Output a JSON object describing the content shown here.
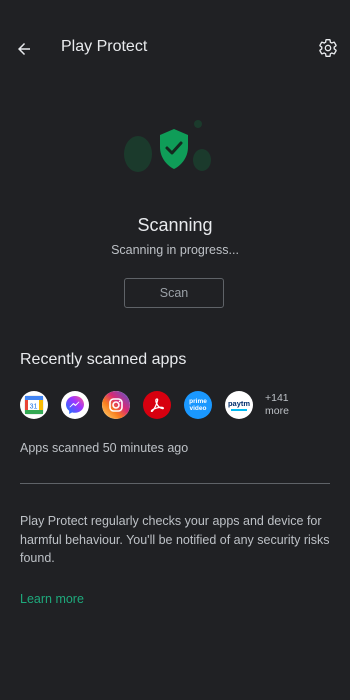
{
  "header": {
    "title": "Play Protect"
  },
  "status": {
    "title": "Scanning",
    "subtitle": "Scanning in progress..."
  },
  "scan_button": {
    "label": "Scan"
  },
  "recent": {
    "title": "Recently scanned apps",
    "apps": [
      {
        "name": "calendar-app-icon",
        "label": "31"
      },
      {
        "name": "messenger-app-icon"
      },
      {
        "name": "instagram-app-icon"
      },
      {
        "name": "acrobat-app-icon"
      },
      {
        "name": "prime-video-app-icon",
        "label_top": "prime",
        "label_bottom": "video"
      },
      {
        "name": "paytm-app-icon",
        "label": "paytm"
      }
    ],
    "more_count": "+141",
    "more_label": "more",
    "scanned_time": "Apps scanned 50 minutes ago"
  },
  "info": {
    "description": "Play Protect regularly checks your apps and device for harmful behaviour. You'll be notified of any security risks found.",
    "learn_more": "Learn more"
  },
  "colors": {
    "background": "#202124",
    "accent": "#1ea97c",
    "shield": "#0f9d58"
  },
  "icons": {
    "back": "arrow-back-icon",
    "settings": "gear-icon",
    "shield": "shield-check-icon"
  }
}
